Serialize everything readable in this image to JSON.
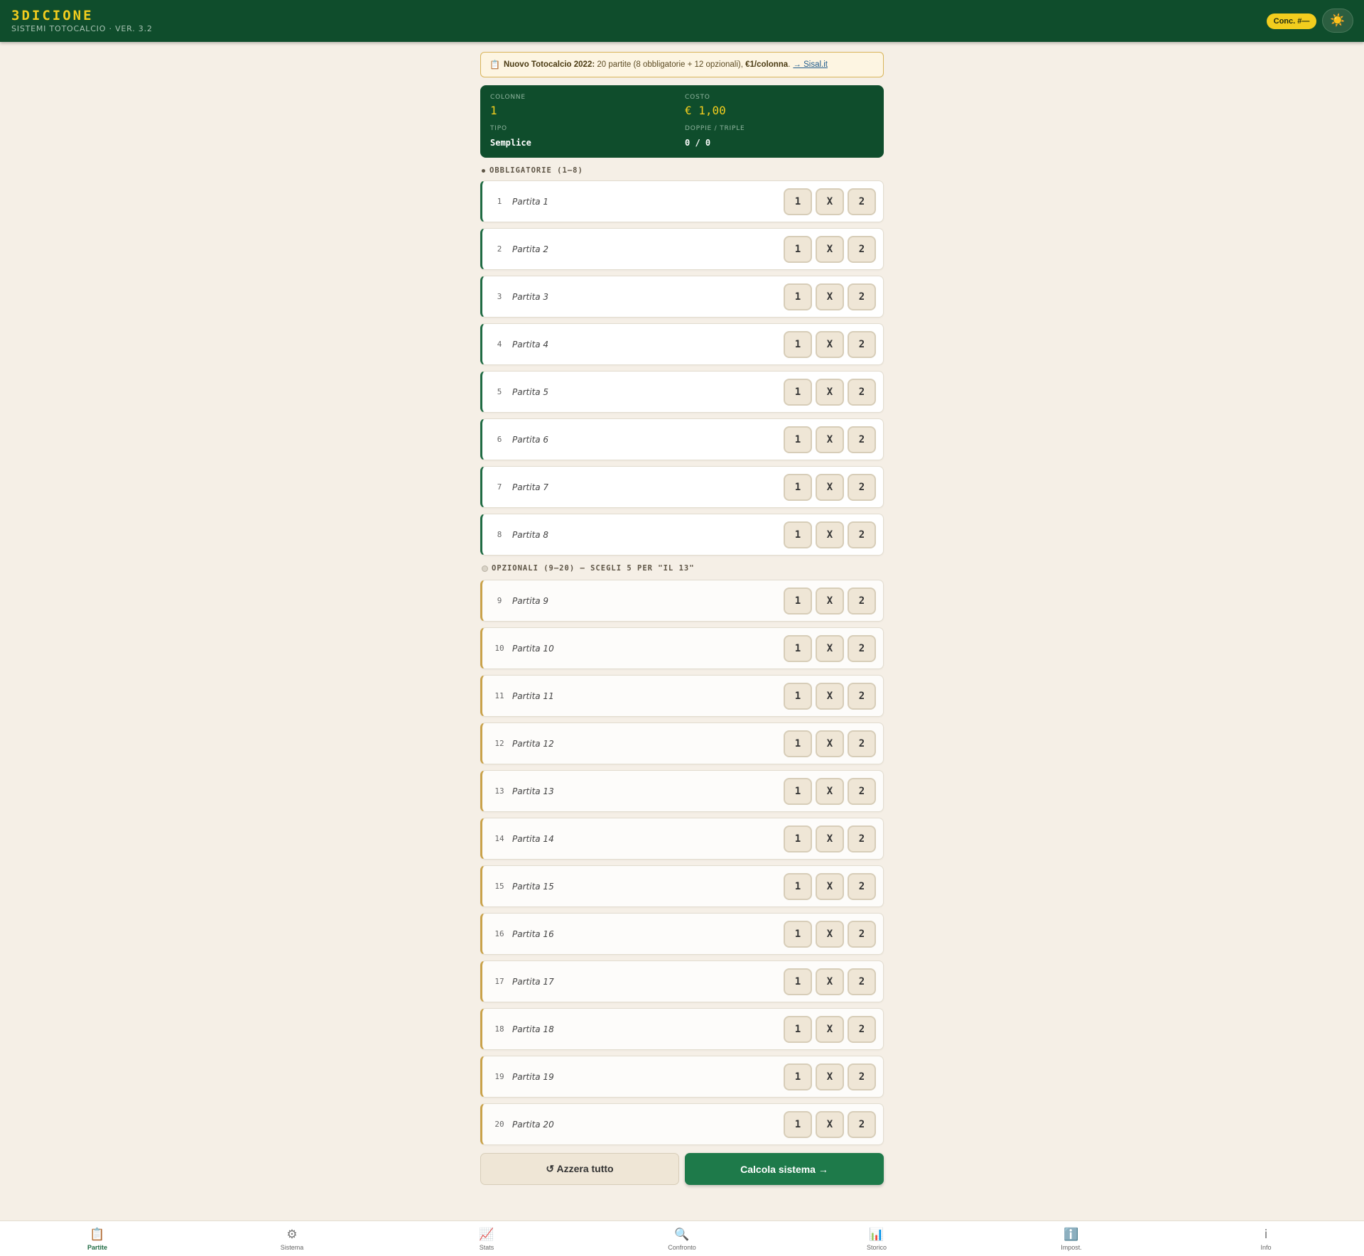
{
  "header": {
    "title": "3DICIONE",
    "subtitle": "SISTEMI TOTOCALCIO · VER. 3.2",
    "conc_badge": "Conc. #—",
    "theme_icon": "sun-icon",
    "theme_glyph": "☀️"
  },
  "notice": {
    "icon_glyph": "📋",
    "bold_text": "Nuovo Totocalcio 2022:",
    "text": " 20 partite (8 obbligatorie + 12 opzionali), ",
    "price": "€1/colonna",
    "period": ".",
    "link": "→ Sisal.it"
  },
  "summary": {
    "colonne_label": "COLONNE",
    "colonne_value": "1",
    "costo_label": "COSTO",
    "costo_value": "€ 1,00",
    "tipo_label": "TIPO",
    "tipo_value": "Semplice",
    "doppie_label": "DOPPIE / TRIPLE",
    "doppie_value": "0 / 0"
  },
  "sections": {
    "required_label": "OBBLIGATORIE (1–8)",
    "optional_label": "OPZIONALI (9–20) — SCEGLI 5 PER \"IL 13\""
  },
  "pick_labels": [
    "1",
    "X",
    "2"
  ],
  "matches": [
    {
      "num": "1",
      "name": "Partita 1"
    },
    {
      "num": "2",
      "name": "Partita 2"
    },
    {
      "num": "3",
      "name": "Partita 3"
    },
    {
      "num": "4",
      "name": "Partita 4"
    },
    {
      "num": "5",
      "name": "Partita 5"
    },
    {
      "num": "6",
      "name": "Partita 6"
    },
    {
      "num": "7",
      "name": "Partita 7"
    },
    {
      "num": "8",
      "name": "Partita 8"
    },
    {
      "num": "9",
      "name": "Partita 9"
    },
    {
      "num": "10",
      "name": "Partita 10"
    },
    {
      "num": "11",
      "name": "Partita 11"
    },
    {
      "num": "12",
      "name": "Partita 12"
    },
    {
      "num": "13",
      "name": "Partita 13"
    },
    {
      "num": "14",
      "name": "Partita 14"
    },
    {
      "num": "15",
      "name": "Partita 15"
    },
    {
      "num": "16",
      "name": "Partita 16"
    },
    {
      "num": "17",
      "name": "Partita 17"
    },
    {
      "num": "18",
      "name": "Partita 18"
    },
    {
      "num": "19",
      "name": "Partita 19"
    },
    {
      "num": "20",
      "name": "Partita 20"
    }
  ],
  "actions": {
    "reset_label": "↺ Azzera tutto",
    "calc_label": "Calcola sistema →"
  },
  "nav": [
    {
      "label": "Partite",
      "icon": "clipboard-icon",
      "glyph": "📋",
      "active": true
    },
    {
      "label": "Sistema",
      "icon": "gear-icon",
      "glyph": "⚙",
      "active": false
    },
    {
      "label": "Stats",
      "icon": "chart-up-icon",
      "glyph": "📈",
      "active": false
    },
    {
      "label": "Confronto",
      "icon": "search-icon",
      "glyph": "🔍",
      "active": false
    },
    {
      "label": "Storico",
      "icon": "bar-chart-icon",
      "glyph": "📊",
      "active": false
    },
    {
      "label": "Impost.",
      "icon": "info-box-icon",
      "glyph": "ℹ️",
      "active": false
    },
    {
      "label": "Info",
      "icon": "info-icon",
      "glyph": "i",
      "active": false
    }
  ],
  "colors": {
    "header_bg": "#0f4d2c",
    "accent_yellow": "#f2cd1e",
    "required_border": "#1f6b43",
    "optional_border": "#c9a24a",
    "primary_button": "#1e7a4a",
    "page_bg": "#f5efe6"
  }
}
